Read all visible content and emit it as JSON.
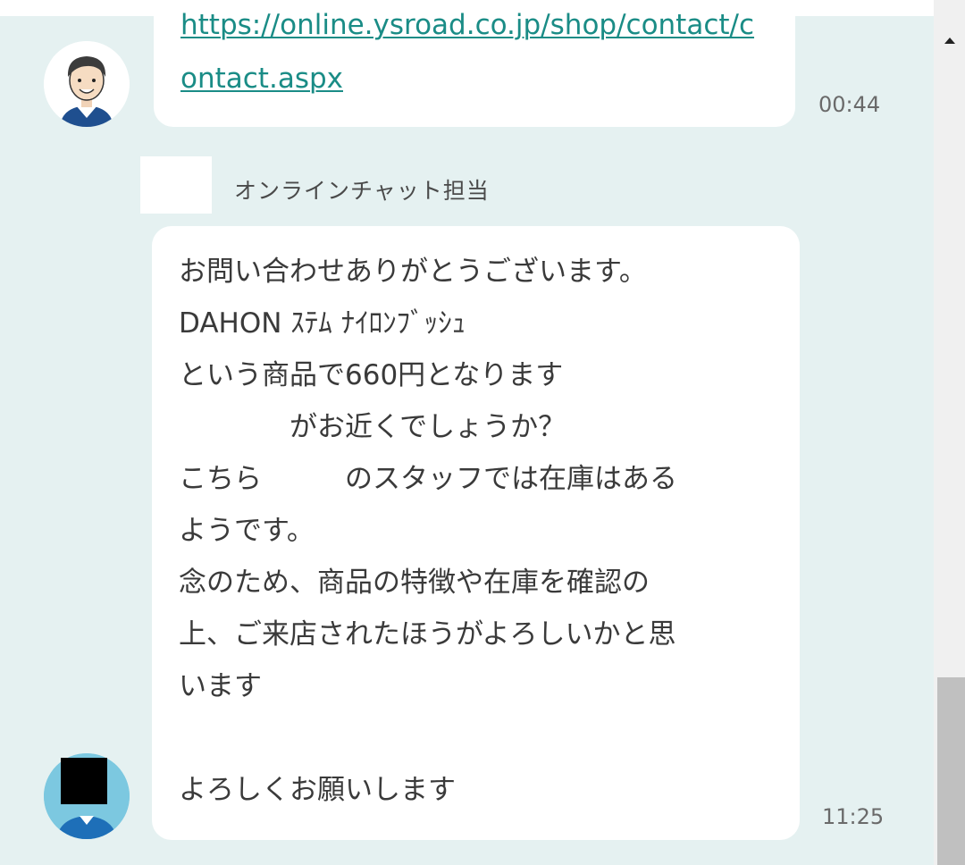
{
  "messages": [
    {
      "link_lines": [
        "https://online.ysroad.co.jp/shop/contact/c",
        "ontact.aspx"
      ],
      "time": "00:44",
      "avatar": "smiling-man-avatar-icon"
    },
    {
      "sender": "オンラインチャット担当",
      "lines": [
        "お問い合わせありがとうございます。",
        "DAHON ｽﾃﾑ ﾅｲﾛﾝﾌﾞｯｼｭ",
        "という商品で660円となります",
        "　　　　がお近くでしょうか？",
        "こちら　　　のスタッフでは在庫はある",
        "ようです。",
        "念のため、商品の特徴や在庫を確認の",
        "上、ご来店されたほうがよろしいかと思",
        "います",
        "",
        "よろしくお願いします"
      ],
      "time": "11:25",
      "avatar": "staff-avatar-icon"
    }
  ],
  "colors": {
    "chat_background": "#e5f1f1",
    "bubble": "#ffffff",
    "link": "#1a8c86",
    "text": "#3a3a3a"
  }
}
